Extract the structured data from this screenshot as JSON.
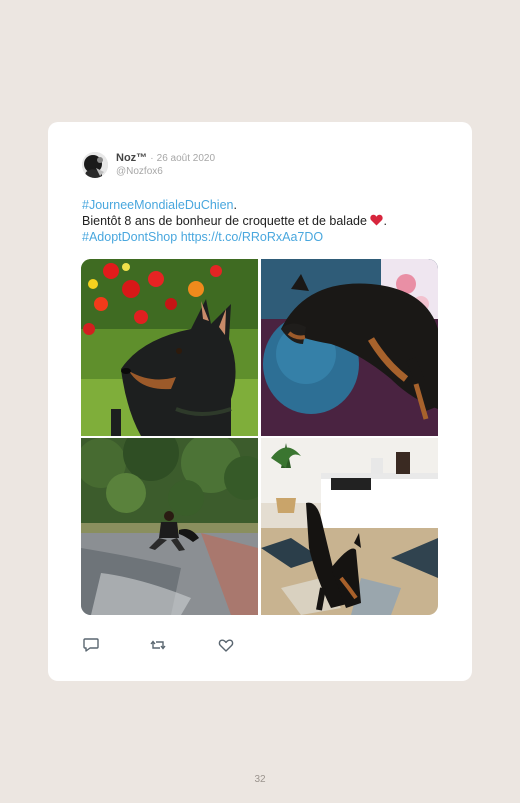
{
  "tweet": {
    "author_name": "Noz™",
    "separator": "·",
    "date": "26 août 2020",
    "handle": "@Nozfox6",
    "hashtag1": "#JourneeMondialeDuChien",
    "text_after_hashtag1": ".",
    "body_line2": "Bientôt 8 ans de bonheur de croquette et de balade",
    "emoji": "red-heart-icon",
    "text_after_emoji": ".",
    "hashtag2": "#AdoptDontShop",
    "url": "https://t.co/RRoRxAa7DO",
    "link_color": "#49a7de"
  },
  "media": {
    "photos": [
      {
        "subject": "dog-in-flowers-photo"
      },
      {
        "subject": "dog-on-cushion-photo"
      },
      {
        "subject": "person-with-dog-on-path-photo"
      },
      {
        "subject": "dog-stretching-on-rug-photo"
      }
    ]
  },
  "actions": {
    "icons": [
      "reply-icon",
      "retweet-icon",
      "like-icon"
    ]
  },
  "page": {
    "number": "32",
    "background": "#ece6e1"
  }
}
